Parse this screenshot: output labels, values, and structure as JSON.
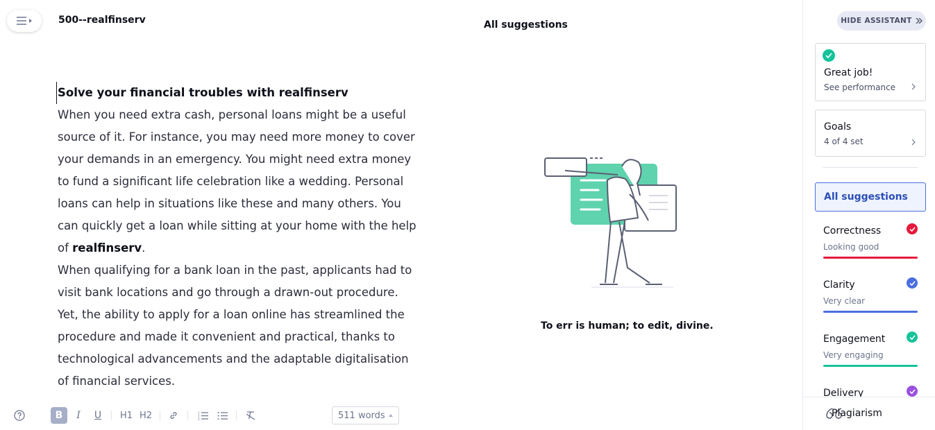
{
  "header": {
    "document_title": "500--realfinserv",
    "center_title": "All suggestions"
  },
  "editor": {
    "heading": "Solve your financial troubles with realfinserv",
    "para1": "When you need extra cash, personal loans might be a useful source of it. For instance, you may need more money to cover your demands in an emergency. You might need extra money to fund a significant life celebration like a wedding. Personal loans can help in situations like these and many others. You can quickly get a loan while sitting at your home with the help of ",
    "para1_bold": "realfinserv",
    "para1_end": ".",
    "para2": "When qualifying for a bank loan in the past, applicants had to visit bank locations and go through a drawn-out procedure. Yet, the ability to apply for a loan online has streamlined the procedure and made it convenient and practical, thanks to technological advancements and the adaptable digitalisation of financial services."
  },
  "center_panel": {
    "tagline": "To err is human; to edit, divine."
  },
  "toolbar": {
    "bold": "B",
    "italic": "I",
    "underline": "U",
    "h1": "H1",
    "h2": "H2",
    "word_count": "511 words"
  },
  "sidebar": {
    "hide_assistant": "HIDE ASSISTANT",
    "performance_card": {
      "title": "Great job!",
      "subtitle": "See performance"
    },
    "goals_card": {
      "title": "Goals",
      "subtitle": "4 of 4 set"
    },
    "all_suggestions": "All suggestions",
    "categories": [
      {
        "name": "Correctness",
        "status": "Looking good",
        "color": "#e5193c"
      },
      {
        "name": "Clarity",
        "status": "Very clear",
        "color": "#4a6ee0"
      },
      {
        "name": "Engagement",
        "status": "Very engaging",
        "color": "#15c39a"
      },
      {
        "name": "Delivery",
        "status": "",
        "color": "#9b51e0"
      }
    ],
    "plagiarism": "Plagiarism"
  },
  "colors": {
    "success": "#15c39a",
    "accent": "#4a6ee0"
  }
}
